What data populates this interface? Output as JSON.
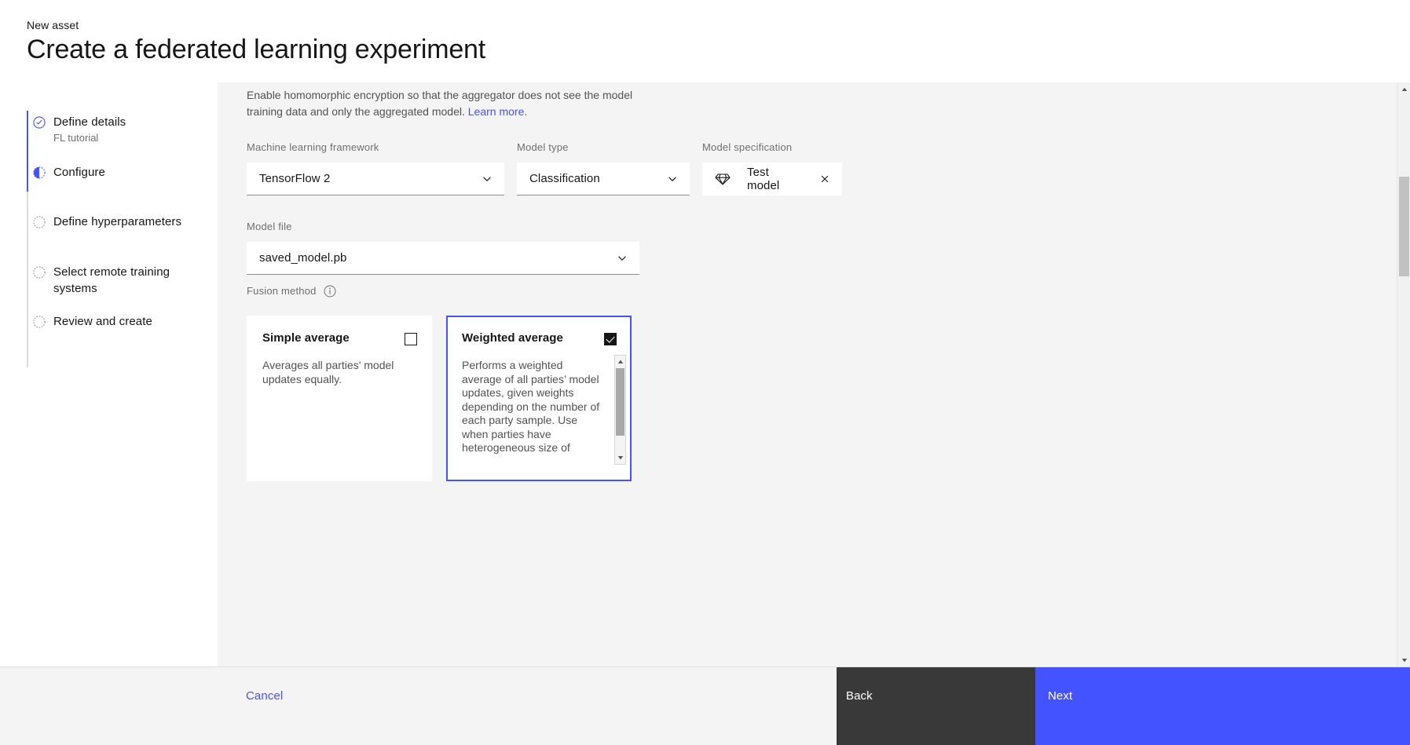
{
  "header": {
    "breadcrumb": "New asset",
    "title": "Create a federated learning experiment"
  },
  "sidebar": {
    "items": [
      {
        "label": "Define details",
        "sublabel": "FL tutorial",
        "state": "complete"
      },
      {
        "label": "Configure",
        "sublabel": "",
        "state": "current"
      },
      {
        "label": "Define hyperparameters",
        "sublabel": "",
        "state": "incomplete"
      },
      {
        "label": "Select remote training systems",
        "sublabel": "",
        "state": "incomplete"
      },
      {
        "label": "Review and create",
        "sublabel": "",
        "state": "incomplete"
      }
    ]
  },
  "main": {
    "intro_text": "Enable homomorphic encryption so that the aggregator does not see the model training data and only the aggregated model.",
    "intro_link": "Learn more",
    "intro_period": ".",
    "fields": {
      "framework_label": "Machine learning framework",
      "framework_value": "TensorFlow 2",
      "model_type_label": "Model type",
      "model_type_value": "Classification",
      "model_spec_label": "Model specification",
      "model_spec_value": "Test model",
      "model_file_label": "Model file",
      "model_file_value": "saved_model.pb",
      "fusion_label": "Fusion method"
    },
    "fusion_cards": [
      {
        "title": "Simple average",
        "description": "Averages all parties' model updates equally.",
        "checked": false
      },
      {
        "title": "Weighted average",
        "description": "Performs a weighted average of all parties’ model updates, given weights depending on the number of each party sample. Use when parties have heterogeneous size of training datasets.",
        "checked": true
      }
    ]
  },
  "actions": {
    "cancel": "Cancel",
    "back": "Back",
    "next": "Next"
  },
  "colors": {
    "accent_blue": "#4353ff",
    "dark_button": "#393939",
    "page_bg": "#f4f4f4",
    "text_primary": "#161616",
    "text_secondary": "#525252",
    "text_muted": "#6f6f6f"
  },
  "icons": {
    "step_complete": "checkmark-circle-icon",
    "step_current": "half-circle-icon",
    "step_incomplete": "dashed-circle-icon",
    "dropdown": "chevron-down-icon",
    "model_chip": "gem-icon",
    "chip_remove": "close-icon",
    "fusion_info": "information-icon"
  }
}
